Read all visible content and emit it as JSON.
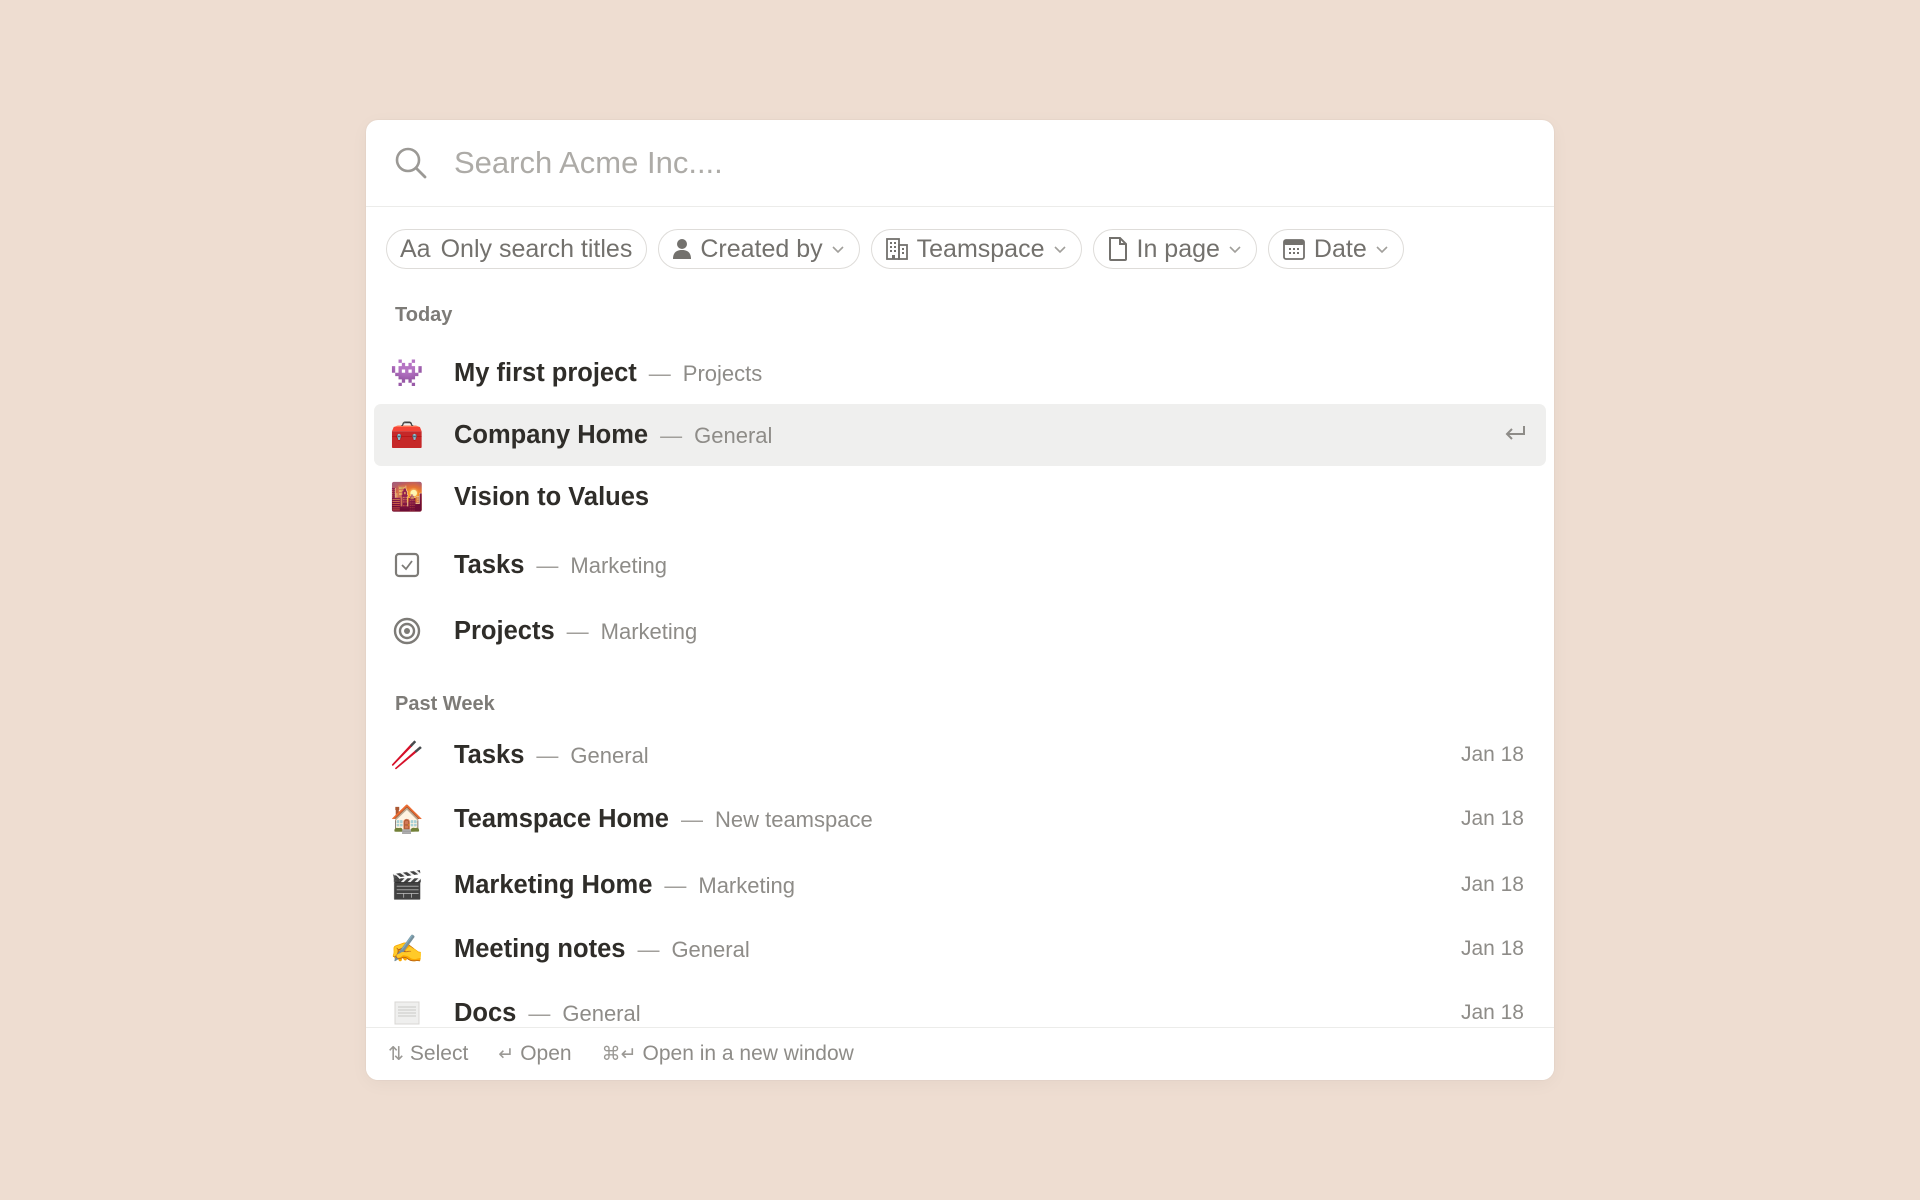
{
  "search": {
    "placeholder": "Search Acme Inc....",
    "value": ""
  },
  "filters": [
    {
      "label": "Only search titles",
      "icon": "text-case-icon",
      "icon_text": "Aa",
      "has_dropdown": false
    },
    {
      "label": "Created by",
      "icon": "person-icon",
      "has_dropdown": true
    },
    {
      "label": "Teamspace",
      "icon": "building-icon",
      "has_dropdown": true
    },
    {
      "label": "In page",
      "icon": "page-icon",
      "has_dropdown": true
    },
    {
      "label": "Date",
      "icon": "calendar-icon",
      "has_dropdown": true
    }
  ],
  "sections": [
    {
      "label": "Today",
      "items": [
        {
          "title": "My first project",
          "path": "Projects",
          "icon": "alien-monster-icon",
          "glyph": "👾",
          "date": "",
          "selected": false
        },
        {
          "title": "Company Home",
          "path": "General",
          "icon": "toolbox-icon",
          "glyph": "🧰",
          "date": "",
          "selected": true
        },
        {
          "title": "Vision to Values",
          "path": "",
          "icon": "city-sunset-icon",
          "glyph": "🌇",
          "date": "",
          "selected": false
        },
        {
          "title": "Tasks",
          "path": "Marketing",
          "icon": "checkbox-icon",
          "glyph": "",
          "date": "",
          "selected": false
        },
        {
          "title": "Projects",
          "path": "Marketing",
          "icon": "target-icon",
          "glyph": "",
          "date": "",
          "selected": false
        }
      ]
    },
    {
      "label": "Past Week",
      "items": [
        {
          "title": "Tasks",
          "path": "General",
          "icon": "chopsticks-icon",
          "glyph": "🥢",
          "date": "Jan 18",
          "selected": false
        },
        {
          "title": "Teamspace Home",
          "path": "New teamspace",
          "icon": "house-icon",
          "glyph": "🏠",
          "date": "Jan 18",
          "selected": false
        },
        {
          "title": "Marketing Home",
          "path": "Marketing",
          "icon": "clapper-board-icon",
          "glyph": "🎬",
          "date": "Jan 18",
          "selected": false
        },
        {
          "title": "Meeting notes",
          "path": "General",
          "icon": "writing-hand-icon",
          "glyph": "✍️",
          "date": "Jan 18",
          "selected": false
        },
        {
          "title": "Docs",
          "path": "General",
          "icon": "document-icon",
          "glyph": "",
          "date": "Jan 18",
          "selected": false
        }
      ]
    }
  ],
  "separator": "—",
  "footer": {
    "hints": [
      {
        "keys": "⇅",
        "label": "Select",
        "icon": "arrows-up-down-icon"
      },
      {
        "keys": "↵",
        "label": "Open",
        "icon": "return-key-icon"
      },
      {
        "keys": "⌘↵",
        "label": "Open in a new window",
        "icon": "command-return-icon"
      }
    ]
  },
  "colors": {
    "background": "#EEDDD1",
    "panel": "#FFFFFF",
    "selected_row": "#EFEFEE",
    "title_text": "#2F2D29",
    "secondary_text": "#8E8C88"
  }
}
